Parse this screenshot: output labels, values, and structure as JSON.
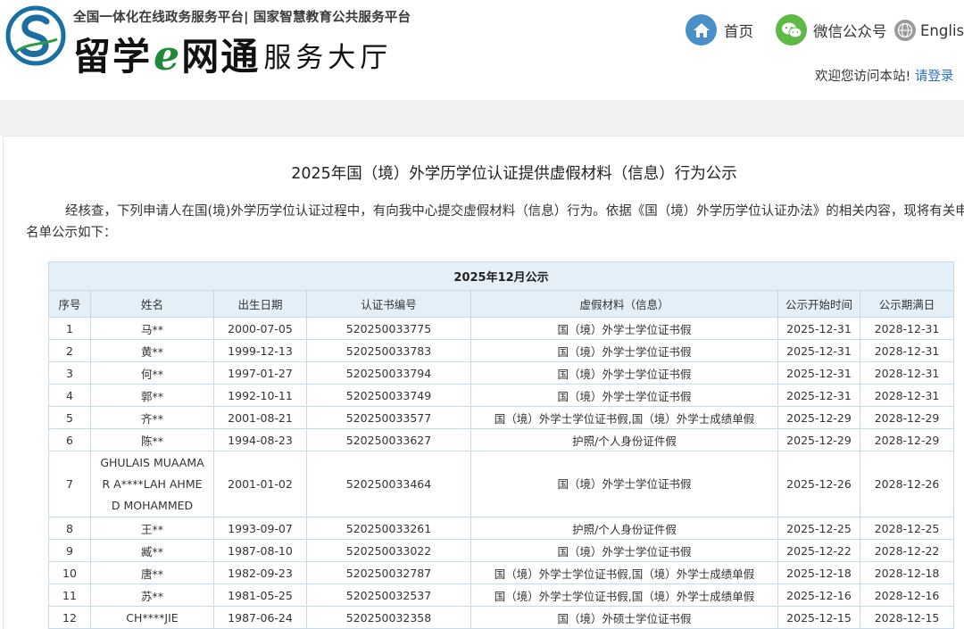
{
  "header": {
    "platform_line": "全国一体化在线政务服务平台| 国家智慧教育公共服务平台",
    "brand_part1": "留学",
    "brand_e": "e",
    "brand_part2": "网通",
    "brand_suffix": "服务大厅",
    "nav": {
      "home": {
        "label": "首页",
        "icon": "home-icon"
      },
      "wechat": {
        "label": "微信公众号",
        "icon": "wechat-icon"
      },
      "english": {
        "label": "English",
        "icon": "globe-icon"
      }
    },
    "welcome_text": "欢迎您访问本站!",
    "login_label": "请登录"
  },
  "colors": {
    "link_blue": "#2a6fc4",
    "table_header_bg": "#e4eff8",
    "table_border": "#c6dbea",
    "brand_green": "#1f8a3b",
    "logo_teal": "#1b6fa0"
  },
  "main": {
    "title": "2025年国（境）外学历学位认证提供虚假材料（信息）行为公示",
    "intro_line1": "经核查，下列申请人在国(境)外学历学位认证过程中，有向我中心提交虚假材料（信息）行为。依据《国（境）外学历学位认证办法》的相关内容，现将有关申请人",
    "intro_line2": "名单公示如下："
  },
  "table": {
    "caption": "2025年12月公示",
    "columns": [
      "序号",
      "姓名",
      "出生日期",
      "认证书编号",
      "虚假材料（信息）",
      "公示开始时间",
      "公示期满日"
    ],
    "rows": [
      [
        "1",
        "马**",
        "2000-07-05",
        "520250033775",
        "国（境）外学士学位证书假",
        "2025-12-31",
        "2028-12-31"
      ],
      [
        "2",
        "黄**",
        "1999-12-13",
        "520250033783",
        "国（境）外学士学位证书假",
        "2025-12-31",
        "2028-12-31"
      ],
      [
        "3",
        "何**",
        "1997-01-27",
        "520250033794",
        "国（境）外学士学位证书假",
        "2025-12-31",
        "2028-12-31"
      ],
      [
        "4",
        "郭**",
        "1992-10-11",
        "520250033749",
        "国（境）外学士学位证书假",
        "2025-12-31",
        "2028-12-31"
      ],
      [
        "5",
        "齐**",
        "2001-08-21",
        "520250033577",
        "国（境）外学士学位证书假,国（境）外学士成绩单假",
        "2025-12-29",
        "2028-12-29"
      ],
      [
        "6",
        "陈**",
        "1994-08-23",
        "520250033627",
        "护照/个人身份证件假",
        "2025-12-29",
        "2028-12-29"
      ],
      [
        "7",
        "GHULAIS MUAAMAR A****LAH AHMED MOHAMMED",
        "2001-01-02",
        "520250033464",
        "国（境）外学士学位证书假",
        "2025-12-26",
        "2028-12-26"
      ],
      [
        "8",
        "王**",
        "1993-09-07",
        "520250033261",
        "护照/个人身份证件假",
        "2025-12-25",
        "2028-12-25"
      ],
      [
        "9",
        "臧**",
        "1987-08-10",
        "520250033022",
        "国（境）外学士学位证书假",
        "2025-12-22",
        "2028-12-22"
      ],
      [
        "10",
        "唐**",
        "1982-09-23",
        "520250032787",
        "国（境）外学士学位证书假,国（境）外学士成绩单假",
        "2025-12-18",
        "2028-12-18"
      ],
      [
        "11",
        "苏**",
        "1981-05-25",
        "520250032537",
        "国（境）外学士学位证书假,国（境）外学士成绩单假",
        "2025-12-16",
        "2028-12-16"
      ],
      [
        "12",
        "CH****JIE",
        "1987-06-24",
        "520250032358",
        "国（境）外硕士学位证书假",
        "2025-12-15",
        "2028-12-15"
      ]
    ]
  }
}
